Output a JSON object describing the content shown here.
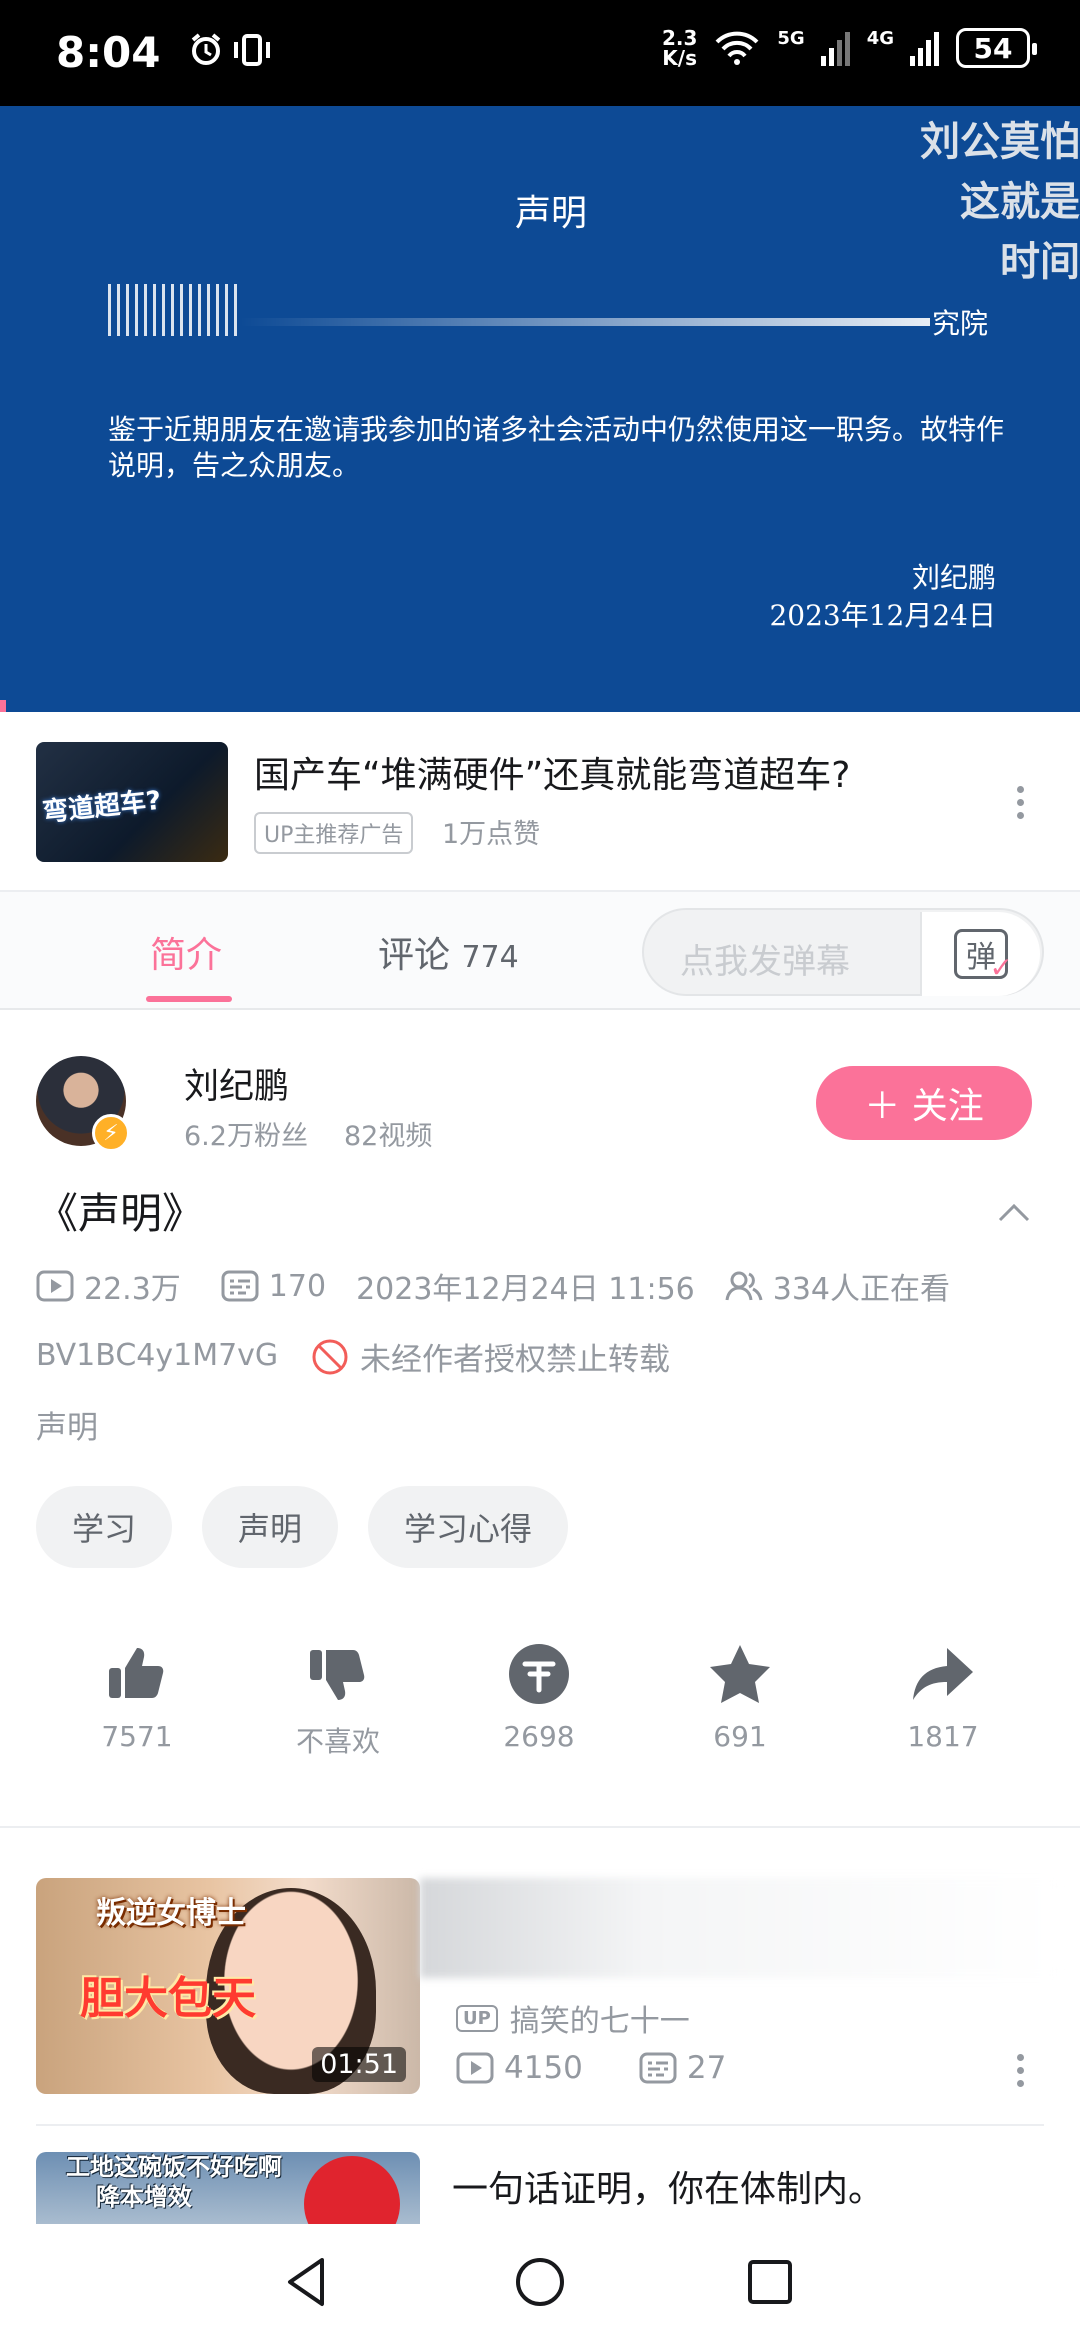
{
  "status_bar": {
    "time": "8:04",
    "net_speed_value": "2.3",
    "net_speed_unit": "K/s",
    "sig1": "5G",
    "sig2": "4G",
    "battery": "54"
  },
  "player": {
    "doc_title": "声明",
    "org_fragment": "究院",
    "body_text": "鉴于近期朋友在邀请我参加的诸多社会活动中仍然使用这一职务。故特作说明，告之众朋友。",
    "signer": "刘纪鹏",
    "date": "2023年12月24日",
    "danmaku": [
      "刘公莫怕",
      "这就是",
      "时间"
    ]
  },
  "ad": {
    "thumb_text": "弯道超车?",
    "title": "国产车“堆满硬件”还真就能弯道超车?",
    "tag": "UP主推荐广告",
    "likes": "1万点赞"
  },
  "tabs": {
    "intro": "简介",
    "comments_label": "评论",
    "comments_count": "774",
    "danmaku_placeholder": "点我发弹幕",
    "danmaku_button": "弹"
  },
  "uploader": {
    "name": "刘纪鹏",
    "fans": "6.2万粉丝",
    "videos": "82视频",
    "follow_label": "＋ 关注"
  },
  "video": {
    "title": "《声明》",
    "plays": "22.3万",
    "danmaku_count": "170",
    "datetime": "2023年12月24日 11:56",
    "watching": "334人正在看",
    "bvid": "BV1BC4y1M7vG",
    "no_repost": "未经作者授权禁止转载",
    "description": "声明",
    "tags": [
      "学习",
      "声明",
      "学习心得"
    ]
  },
  "actions": {
    "like": "7571",
    "dislike": "不喜欢",
    "coin": "2698",
    "favorite": "691",
    "share": "1817"
  },
  "related": [
    {
      "thumb_text_1": "叛逆女博士",
      "thumb_text_2": "胆大包天",
      "duration": "01:51",
      "uploader": "搞笑的七十一",
      "up_badge": "UP",
      "plays": "4150",
      "danmaku": "27"
    },
    {
      "thumb_text": "工地这碗饭不好吃啊\n降本增效",
      "title": "一句话证明，你在体制内。"
    }
  ],
  "colors": {
    "accent": "#fb7299",
    "video_bg": "#0d4a95",
    "text_secondary": "#9499a0"
  }
}
